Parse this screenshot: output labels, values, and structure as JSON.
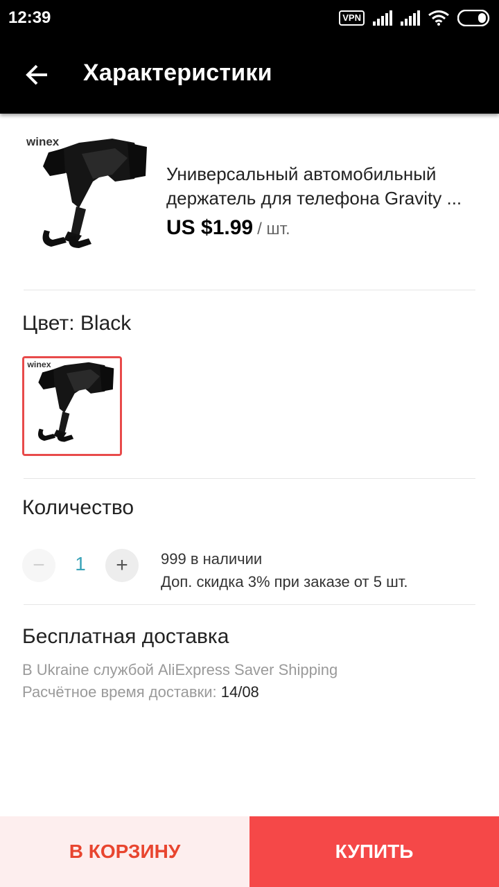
{
  "status_bar": {
    "time": "12:39",
    "vpn_label": "VPN",
    "icons": [
      "vpn-icon",
      "signal-icon",
      "signal-icon",
      "wifi-icon",
      "battery-icon"
    ]
  },
  "header": {
    "title": "Характеристики",
    "back_icon": "arrow-left-icon"
  },
  "product": {
    "image_brand": "winex",
    "title": "Универсальный автомобильный держатель для телефона Gravity ...",
    "price": "US $1.99",
    "unit": "/ шт."
  },
  "color": {
    "label": "Цвет: Black",
    "selected_swatch_brand": "winex",
    "selected_border_color": "#e84a4a"
  },
  "quantity": {
    "label": "Количество",
    "minus_symbol": "−",
    "value": "1",
    "plus_symbol": "+",
    "stock": "999 в наличии",
    "discount": "Доп. скидка 3% при заказе от 5 шт."
  },
  "shipping": {
    "title": "Бесплатная доставка",
    "method": "В Ukraine службой AliExpress Saver Shipping",
    "eta_label": "Расчётное время доставки:",
    "eta_date": "14/08"
  },
  "actions": {
    "cart_label": "В КОРЗИНУ",
    "buy_label": "КУПИТЬ",
    "accent_color": "#f54848",
    "cart_bg_color": "#fdeeee"
  }
}
